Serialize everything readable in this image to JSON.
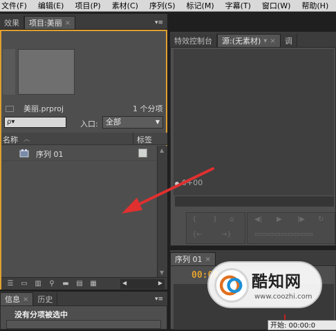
{
  "menu": [
    "文件(F)",
    "编辑(E)",
    "项目(P)",
    "素材(C)",
    "序列(S)",
    "标记(M)",
    "字幕(T)",
    "窗口(W)",
    "帮助(H)"
  ],
  "left_panel": {
    "tabs": [
      {
        "label": "效果"
      },
      {
        "label": "项目:美丽",
        "close": "×"
      }
    ],
    "menu_glyph": "▾≡",
    "project_file": "美丽.prproj",
    "item_count": "1 个分项",
    "search_placeholder": "ρ▾",
    "entry_label": "入口:",
    "entry_value": "全部",
    "columns": {
      "name": "名称",
      "label": "标签"
    },
    "rows": [
      {
        "name": "序列 01"
      }
    ]
  },
  "info_panel": {
    "tabs": [
      {
        "label": "信息",
        "close": "×"
      },
      {
        "label": "历史"
      }
    ],
    "menu_glyph": "▾≡",
    "message": "没有分项被选中"
  },
  "source_panel": {
    "tabs": [
      {
        "label": "特效控制台"
      },
      {
        "label": "源:(无素材)",
        "close": "×"
      },
      {
        "label": "调"
      }
    ],
    "menu_glyph": "▾",
    "timecode": "0+00"
  },
  "sequence_panel": {
    "tab": {
      "label": "序列 01",
      "close": "×"
    },
    "timecode": "00:00:00",
    "start_label": "开始: 00:00:0"
  },
  "watermark": {
    "brand": "酷知网",
    "url": "www.coozhi.com"
  },
  "colors": {
    "accent_orange": "#e0a030",
    "arrow_red": "#e03030",
    "panel_bg": "#4e4e4e",
    "playhead": "#c02020"
  }
}
